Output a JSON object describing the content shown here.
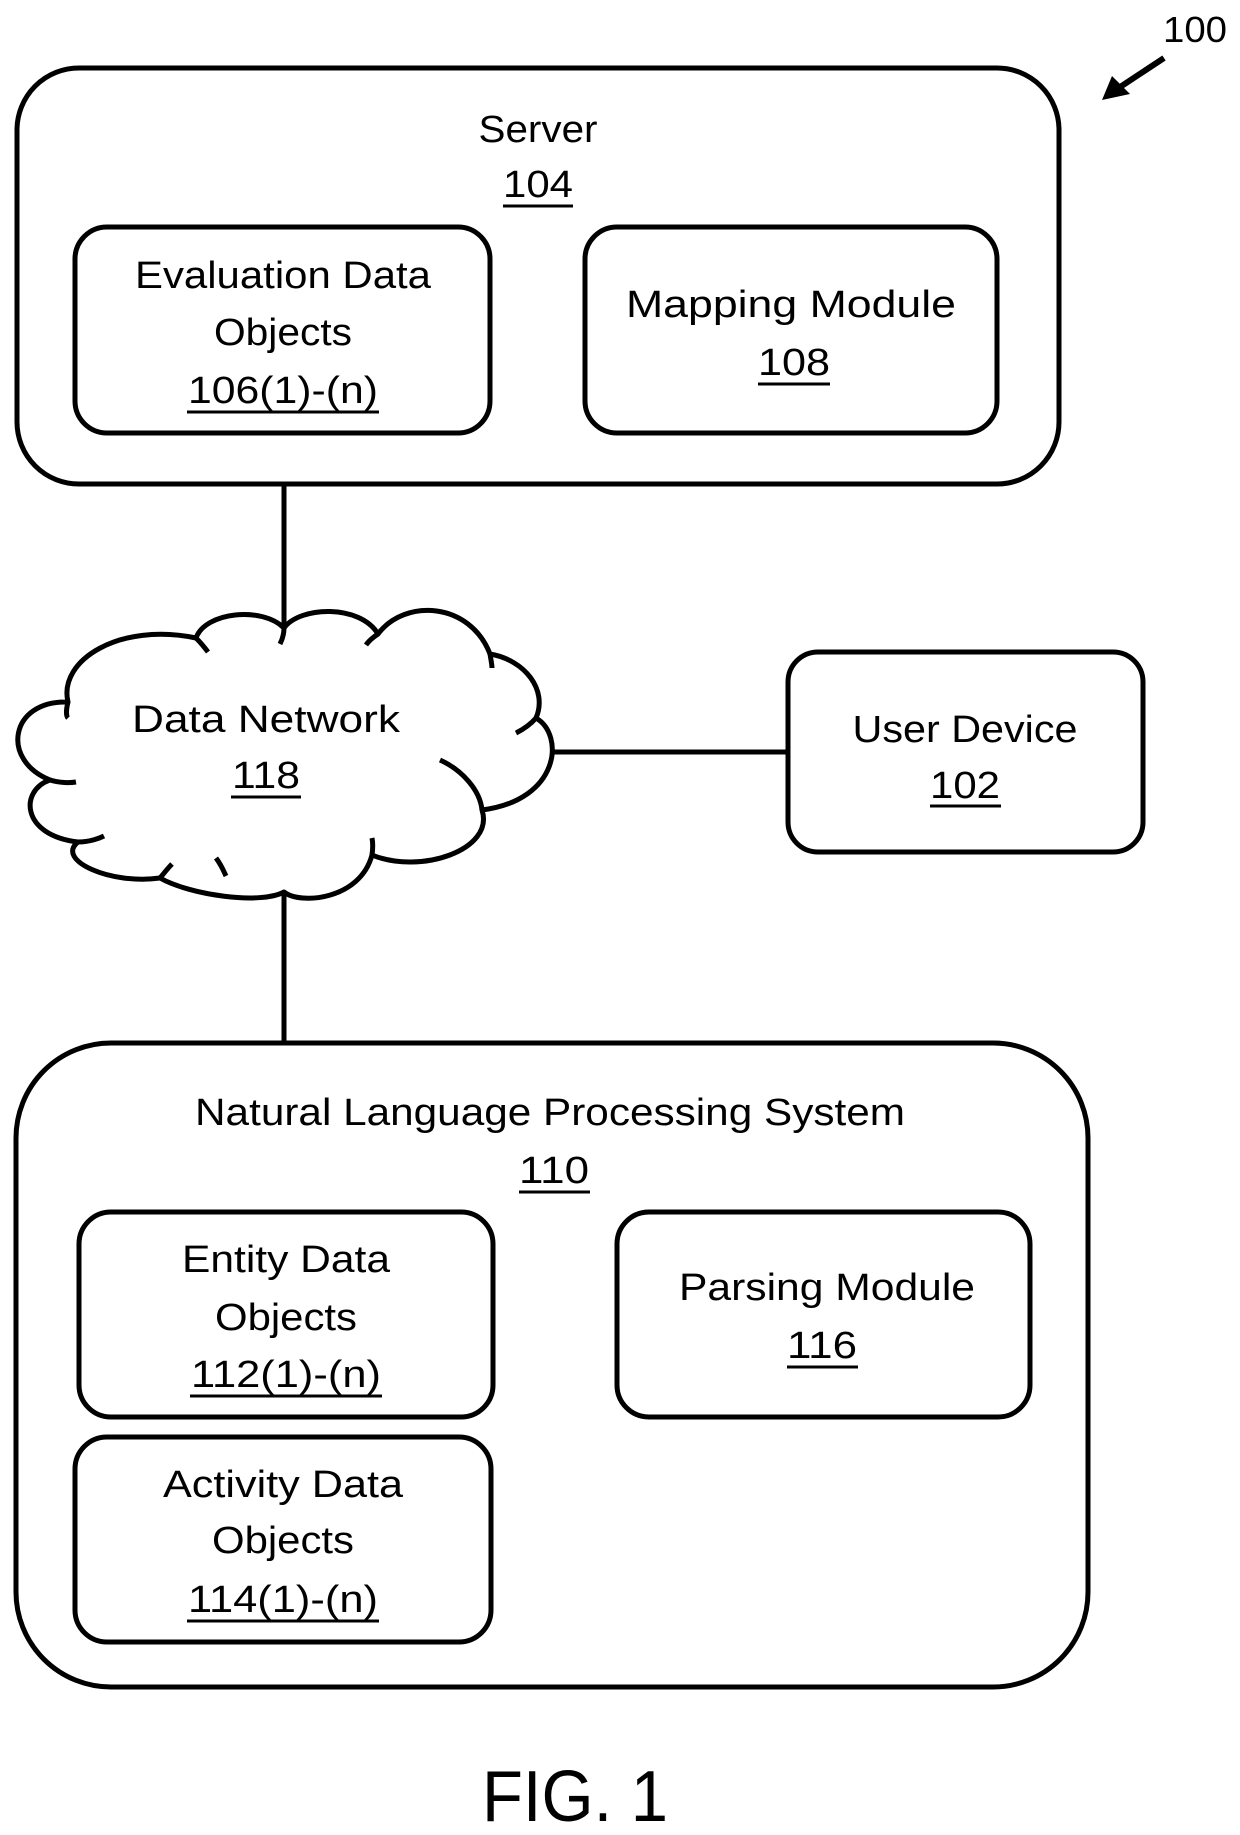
{
  "figure": {
    "reference_numeral": "100",
    "caption": "FIG. 1"
  },
  "server": {
    "title": "Server",
    "ref": "104",
    "components": [
      {
        "lines": [
          "Evaluation Data",
          "Objects"
        ],
        "ref": "106(1)-(n)"
      },
      {
        "lines": [
          "Mapping Module"
        ],
        "ref": "108"
      }
    ]
  },
  "network": {
    "title": "Data Network",
    "ref": "118"
  },
  "user_device": {
    "title": "User Device",
    "ref": "102"
  },
  "nlp_system": {
    "title": "Natural Language Processing System",
    "ref": "110",
    "components": [
      {
        "lines": [
          "Entity Data",
          "Objects"
        ],
        "ref": "112(1)-(n)"
      },
      {
        "lines": [
          "Activity Data",
          "Objects"
        ],
        "ref": "114(1)-(n)"
      },
      {
        "lines": [
          "Parsing Module"
        ],
        "ref": "116"
      }
    ]
  },
  "connections": [
    {
      "from": "Server 104",
      "to": "Data Network 118"
    },
    {
      "from": "Data Network 118",
      "to": "User Device 102"
    },
    {
      "from": "Data Network 118",
      "to": "Natural Language Processing System 110"
    }
  ]
}
